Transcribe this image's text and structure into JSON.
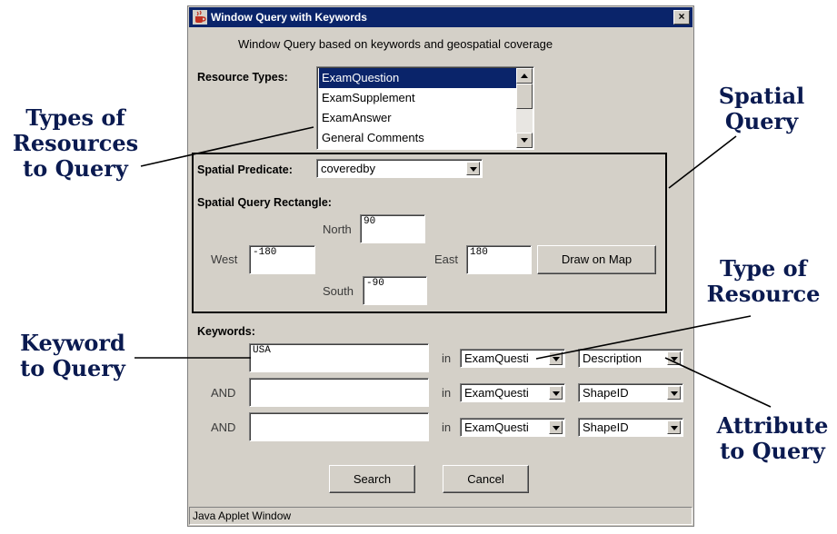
{
  "window": {
    "title": "Window Query with Keywords",
    "close_label": "×",
    "subtitle": "Window Query based on keywords and geospatial coverage",
    "status": "Java Applet Window"
  },
  "resource_types": {
    "label": "Resource Types:",
    "items": [
      "ExamQuestion",
      "ExamSupplement",
      "ExamAnswer",
      "General Comments"
    ],
    "selected": "ExamQuestion"
  },
  "spatial": {
    "predicate_label": "Spatial Predicate:",
    "predicate_value": "coveredby",
    "rect_label": "Spatial Query Rectangle:",
    "north_label": "North",
    "north_value": "90",
    "west_label": "West",
    "west_value": "-180",
    "east_label": "East",
    "east_value": "180",
    "south_label": "South",
    "south_value": "-90",
    "draw_button": "Draw on Map"
  },
  "keywords": {
    "label": "Keywords:",
    "rows": [
      {
        "conj": "",
        "value": "USA",
        "in_label": "in",
        "type": "ExamQuesti",
        "attribute": "Description"
      },
      {
        "conj": "AND",
        "value": "",
        "in_label": "in",
        "type": "ExamQuesti",
        "attribute": "ShapeID"
      },
      {
        "conj": "AND",
        "value": "",
        "in_label": "in",
        "type": "ExamQuesti",
        "attribute": "ShapeID"
      }
    ]
  },
  "buttons": {
    "search": "Search",
    "cancel": "Cancel"
  },
  "annotations": {
    "types_of_resources": [
      "Types of",
      "Resources",
      "to Query"
    ],
    "spatial_query": [
      "Spatial",
      "Query"
    ],
    "type_of_resource": [
      "Type of",
      "Resource"
    ],
    "keyword_to_query": [
      "Keyword",
      "to Query"
    ],
    "attribute_to_query": [
      "Attribute",
      "to Query"
    ]
  },
  "colors": {
    "titlebar": "#0a246a",
    "selection": "#0a246a",
    "window_bg": "#d4d0c8",
    "annotation_text": "#0a1a50"
  },
  "icons": {
    "title_icon": "java-cup-icon",
    "close": "close-icon"
  }
}
